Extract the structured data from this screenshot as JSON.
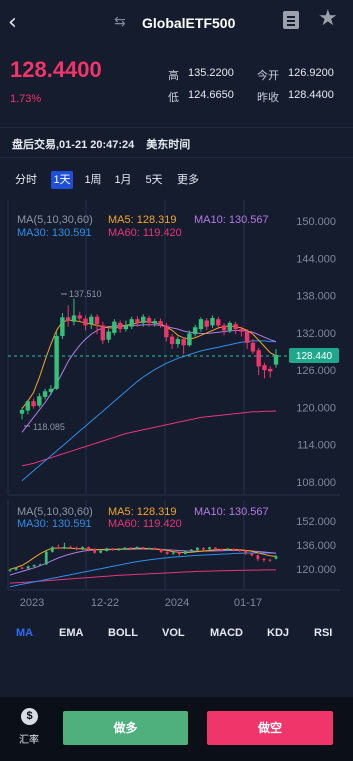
{
  "header": {
    "title": "GlobalETF500",
    "back_icon": "chevron-left-icon",
    "swap_icon": "swap-icon",
    "doc_icon": "document-icon",
    "star_icon": "star-icon"
  },
  "quote": {
    "price": "128.4400",
    "change_pct": "1.73%",
    "high_label": "高",
    "high_value": "135.2200",
    "open_label": "今开",
    "open_value": "126.9200",
    "low_label": "低",
    "low_value": "124.6650",
    "prev_close_label": "昨收",
    "prev_close_value": "128.4400"
  },
  "session": {
    "text": "盘后交易,01-21 20:47:24",
    "timezone": "美东时间"
  },
  "periods": [
    "分时",
    "1天",
    "1周",
    "1月",
    "5天",
    "更多"
  ],
  "active_period": "1天",
  "chart": {
    "main_legend": {
      "params": "MA(5,10,30,60)",
      "ma5": "MA5: 128.319",
      "ma10": "MA10: 130.567",
      "ma30": "MA30: 130.591",
      "ma60": "MA60: 119.420"
    },
    "mini_legend": {
      "params": "MA(5,10,30,60)",
      "ma5": "MA5: 128.319",
      "ma10": "MA10: 130.567",
      "ma30": "MA30: 130.591",
      "ma60": "MA60: 119.420"
    },
    "y_ticks": [
      "150.000",
      "144.000",
      "138.000",
      "132.000",
      "126.000",
      "120.000",
      "114.000",
      "108.000"
    ],
    "mini_y_ticks": [
      "152.000",
      "136.000",
      "120.000"
    ],
    "x_ticks": [
      "2023",
      "12-22",
      "2024",
      "01-17"
    ],
    "high_marker": "137.510",
    "low_marker": "118.085",
    "last_price_tag": "128.440",
    "colors": {
      "ma5": "#f5a623",
      "ma10": "#b57be6",
      "ma30": "#2f8fe8",
      "ma60": "#e8357a",
      "up": "#34c27a",
      "down": "#f0356a"
    }
  },
  "chart_data": {
    "type": "candlestick",
    "ylim": [
      108,
      150
    ],
    "high": 137.51,
    "low": 118.085,
    "last": 128.44,
    "candles": [
      [
        119.0,
        119.6,
        118.1,
        120.0
      ],
      [
        119.5,
        121.0,
        118.9,
        121.2
      ],
      [
        121.0,
        120.2,
        119.8,
        121.4
      ],
      [
        120.3,
        121.8,
        120.0,
        122.3
      ],
      [
        121.7,
        122.6,
        121.3,
        123.0
      ],
      [
        122.5,
        123.0,
        122.0,
        123.6
      ],
      [
        123.0,
        131.5,
        122.8,
        132.2
      ],
      [
        131.5,
        134.5,
        131.0,
        135.2
      ],
      [
        134.5,
        133.9,
        133.0,
        136.4
      ],
      [
        133.8,
        134.8,
        133.2,
        137.51
      ],
      [
        134.8,
        134.3,
        133.8,
        135.4
      ],
      [
        134.3,
        133.2,
        132.4,
        134.8
      ],
      [
        133.4,
        134.6,
        132.6,
        135.0
      ],
      [
        134.6,
        133.4,
        131.8,
        135.0
      ],
      [
        133.2,
        130.8,
        130.2,
        133.8
      ],
      [
        130.9,
        132.2,
        130.4,
        132.6
      ],
      [
        132.0,
        133.8,
        131.6,
        134.2
      ],
      [
        133.6,
        132.6,
        132.0,
        134.0
      ],
      [
        132.6,
        133.2,
        132.2,
        134.0
      ],
      [
        133.0,
        134.2,
        132.6,
        134.6
      ],
      [
        134.2,
        133.6,
        133.0,
        134.7
      ],
      [
        133.6,
        134.6,
        133.0,
        135.0
      ],
      [
        134.4,
        133.6,
        133.0,
        134.8
      ],
      [
        133.5,
        133.9,
        133.0,
        134.3
      ],
      [
        133.9,
        133.3,
        132.8,
        134.3
      ],
      [
        133.2,
        131.3,
        130.6,
        133.6
      ],
      [
        131.4,
        130.2,
        129.4,
        131.8
      ],
      [
        130.2,
        131.0,
        129.6,
        131.4
      ],
      [
        131.0,
        130.0,
        128.6,
        131.3
      ],
      [
        130.0,
        131.9,
        129.8,
        132.4
      ],
      [
        131.8,
        132.9,
        131.4,
        133.3
      ],
      [
        132.6,
        134.2,
        132.2,
        134.5
      ],
      [
        134.0,
        133.0,
        132.4,
        134.4
      ],
      [
        133.2,
        134.4,
        132.8,
        134.8
      ],
      [
        134.2,
        133.2,
        132.6,
        134.6
      ],
      [
        133.2,
        132.4,
        131.6,
        133.6
      ],
      [
        132.4,
        133.6,
        132.0,
        133.9
      ],
      [
        133.4,
        132.6,
        131.8,
        133.8
      ],
      [
        132.6,
        132.2,
        131.4,
        133.0
      ],
      [
        132.2,
        130.4,
        129.4,
        132.6
      ],
      [
        130.4,
        129.0,
        128.6,
        131.0
      ],
      [
        129.2,
        126.6,
        125.2,
        129.6
      ],
      [
        126.8,
        126.0,
        124.665,
        127.2
      ],
      [
        126.2,
        125.8,
        124.8,
        126.6
      ],
      [
        126.9,
        128.44,
        126.4,
        129.4
      ]
    ],
    "ma5": [
      119.8,
      121.0,
      122.4,
      124.8,
      127.6,
      130.2,
      132.4,
      133.8,
      134.0,
      134.0,
      133.8,
      133.6,
      133.4,
      133.2,
      133.0,
      132.8,
      132.8,
      133.0,
      133.2,
      133.4,
      133.6,
      133.8,
      133.8,
      133.6,
      133.4,
      133.0,
      132.4,
      131.6,
      131.2,
      131.0,
      131.2,
      131.6,
      132.0,
      132.4,
      132.8,
      133.0,
      133.1,
      133.0,
      132.8,
      132.4,
      131.8,
      130.8,
      129.8,
      128.8,
      128.3
    ],
    "ma10": [
      116.0,
      117.2,
      118.4,
      119.6,
      120.8,
      122.2,
      123.8,
      125.6,
      127.4,
      128.8,
      130.0,
      131.0,
      131.8,
      132.4,
      132.8,
      133.0,
      133.1,
      133.2,
      133.2,
      133.2,
      133.2,
      133.3,
      133.3,
      133.3,
      133.2,
      133.0,
      132.8,
      132.6,
      132.3,
      132.1,
      132.0,
      131.9,
      131.9,
      132.0,
      132.1,
      132.2,
      132.3,
      132.4,
      132.4,
      132.3,
      132.1,
      131.7,
      131.3,
      130.9,
      130.6
    ],
    "ma30": [
      108.2,
      109.0,
      109.8,
      110.6,
      111.4,
      112.2,
      113.0,
      113.8,
      114.6,
      115.4,
      116.2,
      117.0,
      117.8,
      118.6,
      119.4,
      120.2,
      121.0,
      121.8,
      122.6,
      123.4,
      124.2,
      124.9,
      125.5,
      126.1,
      126.6,
      127.1,
      127.5,
      127.9,
      128.2,
      128.5,
      128.8,
      129.1,
      129.3,
      129.5,
      129.7,
      129.9,
      130.1,
      130.3,
      130.5,
      130.6,
      130.7,
      130.7,
      130.7,
      130.6,
      130.6
    ],
    "ma60": [
      110.6,
      110.8,
      111.0,
      111.3,
      111.6,
      111.9,
      112.2,
      112.5,
      112.8,
      113.1,
      113.4,
      113.7,
      114.0,
      114.3,
      114.6,
      114.9,
      115.2,
      115.5,
      115.8,
      116.0,
      116.2,
      116.4,
      116.6,
      116.8,
      117.0,
      117.2,
      117.4,
      117.6,
      117.8,
      118.0,
      118.2,
      118.4,
      118.5,
      118.6,
      118.7,
      118.8,
      118.9,
      119.0,
      119.1,
      119.2,
      119.3,
      119.3,
      119.4,
      119.4,
      119.42
    ]
  },
  "indicators": [
    "MA",
    "EMA",
    "BOLL",
    "VOL",
    "MACD",
    "KDJ",
    "RSI"
  ],
  "active_indicator": "MA",
  "footer": {
    "fx_icon_glyph": "$",
    "fx_label": "汇率",
    "buy_label": "做多",
    "sell_label": "做空",
    "buy_color": "#4fb07e",
    "sell_color": "#f0356a"
  }
}
